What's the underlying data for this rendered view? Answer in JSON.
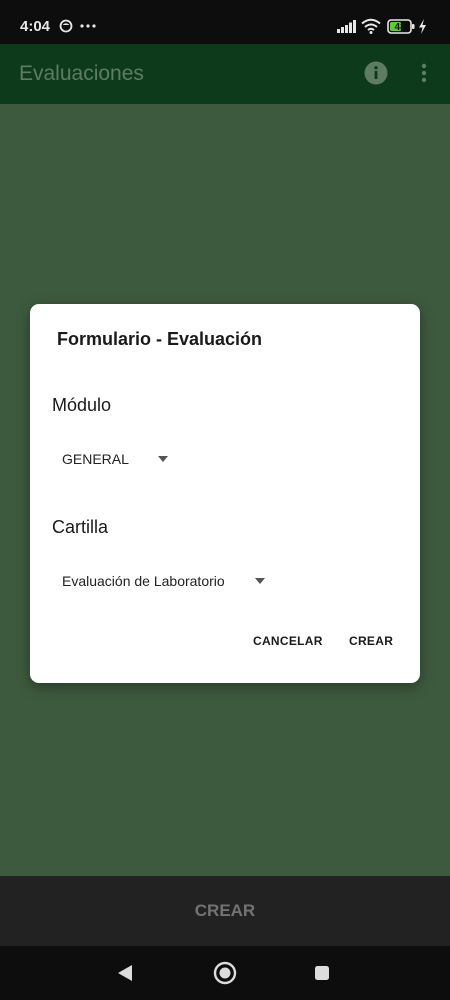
{
  "status_bar": {
    "time": "4:04",
    "battery_level": "48"
  },
  "app_bar": {
    "title": "Evaluaciones"
  },
  "dialog": {
    "title": "Formulario - Evaluación",
    "module": {
      "label": "Módulo",
      "selected": "GENERAL"
    },
    "cartilla": {
      "label": "Cartilla",
      "selected": "Evaluación de Laboratorio"
    },
    "cancel_label": "CANCELAR",
    "create_label": "CREAR"
  },
  "bottom_bar": {
    "create_label": "CREAR"
  },
  "icons": {
    "app_notification": "face-icon",
    "more_notifications": "ellipsis-icon",
    "signal": "signal-icon",
    "wifi": "wifi-icon",
    "battery": "battery-icon",
    "charging": "charging-icon",
    "info": "info-icon",
    "overflow": "more-vert-icon",
    "nav_back": "back-icon",
    "nav_home": "home-icon",
    "nav_recents": "recents-icon"
  },
  "colors": {
    "status_bar_bg": "#0d0d0d",
    "app_bar_bg": "#0e3a1c",
    "scrim_bg": "#3d5a3e",
    "dialog_bg": "#ffffff",
    "bottom_bar_bg": "#222222"
  }
}
